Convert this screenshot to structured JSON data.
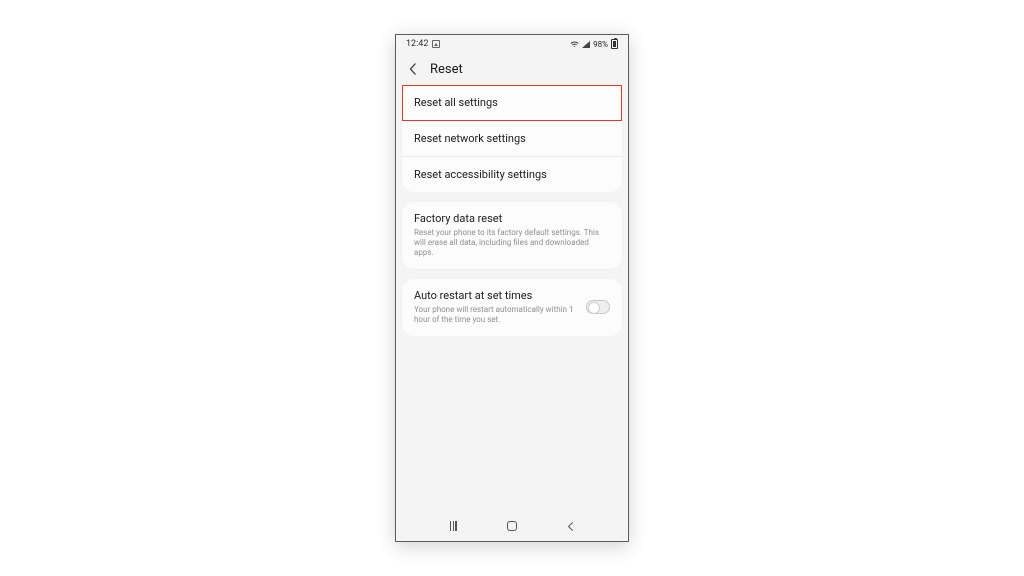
{
  "status": {
    "time": "12:42",
    "battery_pct": "98%"
  },
  "header": {
    "title": "Reset"
  },
  "group1": {
    "items": [
      {
        "label": "Reset all settings",
        "highlighted": true
      },
      {
        "label": "Reset network settings"
      },
      {
        "label": "Reset accessibility settings"
      }
    ]
  },
  "group2": {
    "title": "Factory data reset",
    "subtitle": "Reset your phone to its factory default settings. This will erase all data, including files and downloaded apps."
  },
  "group3": {
    "title": "Auto restart at set times",
    "subtitle": "Your phone will restart automatically within 1 hour of the time you set.",
    "toggle_on": false
  }
}
